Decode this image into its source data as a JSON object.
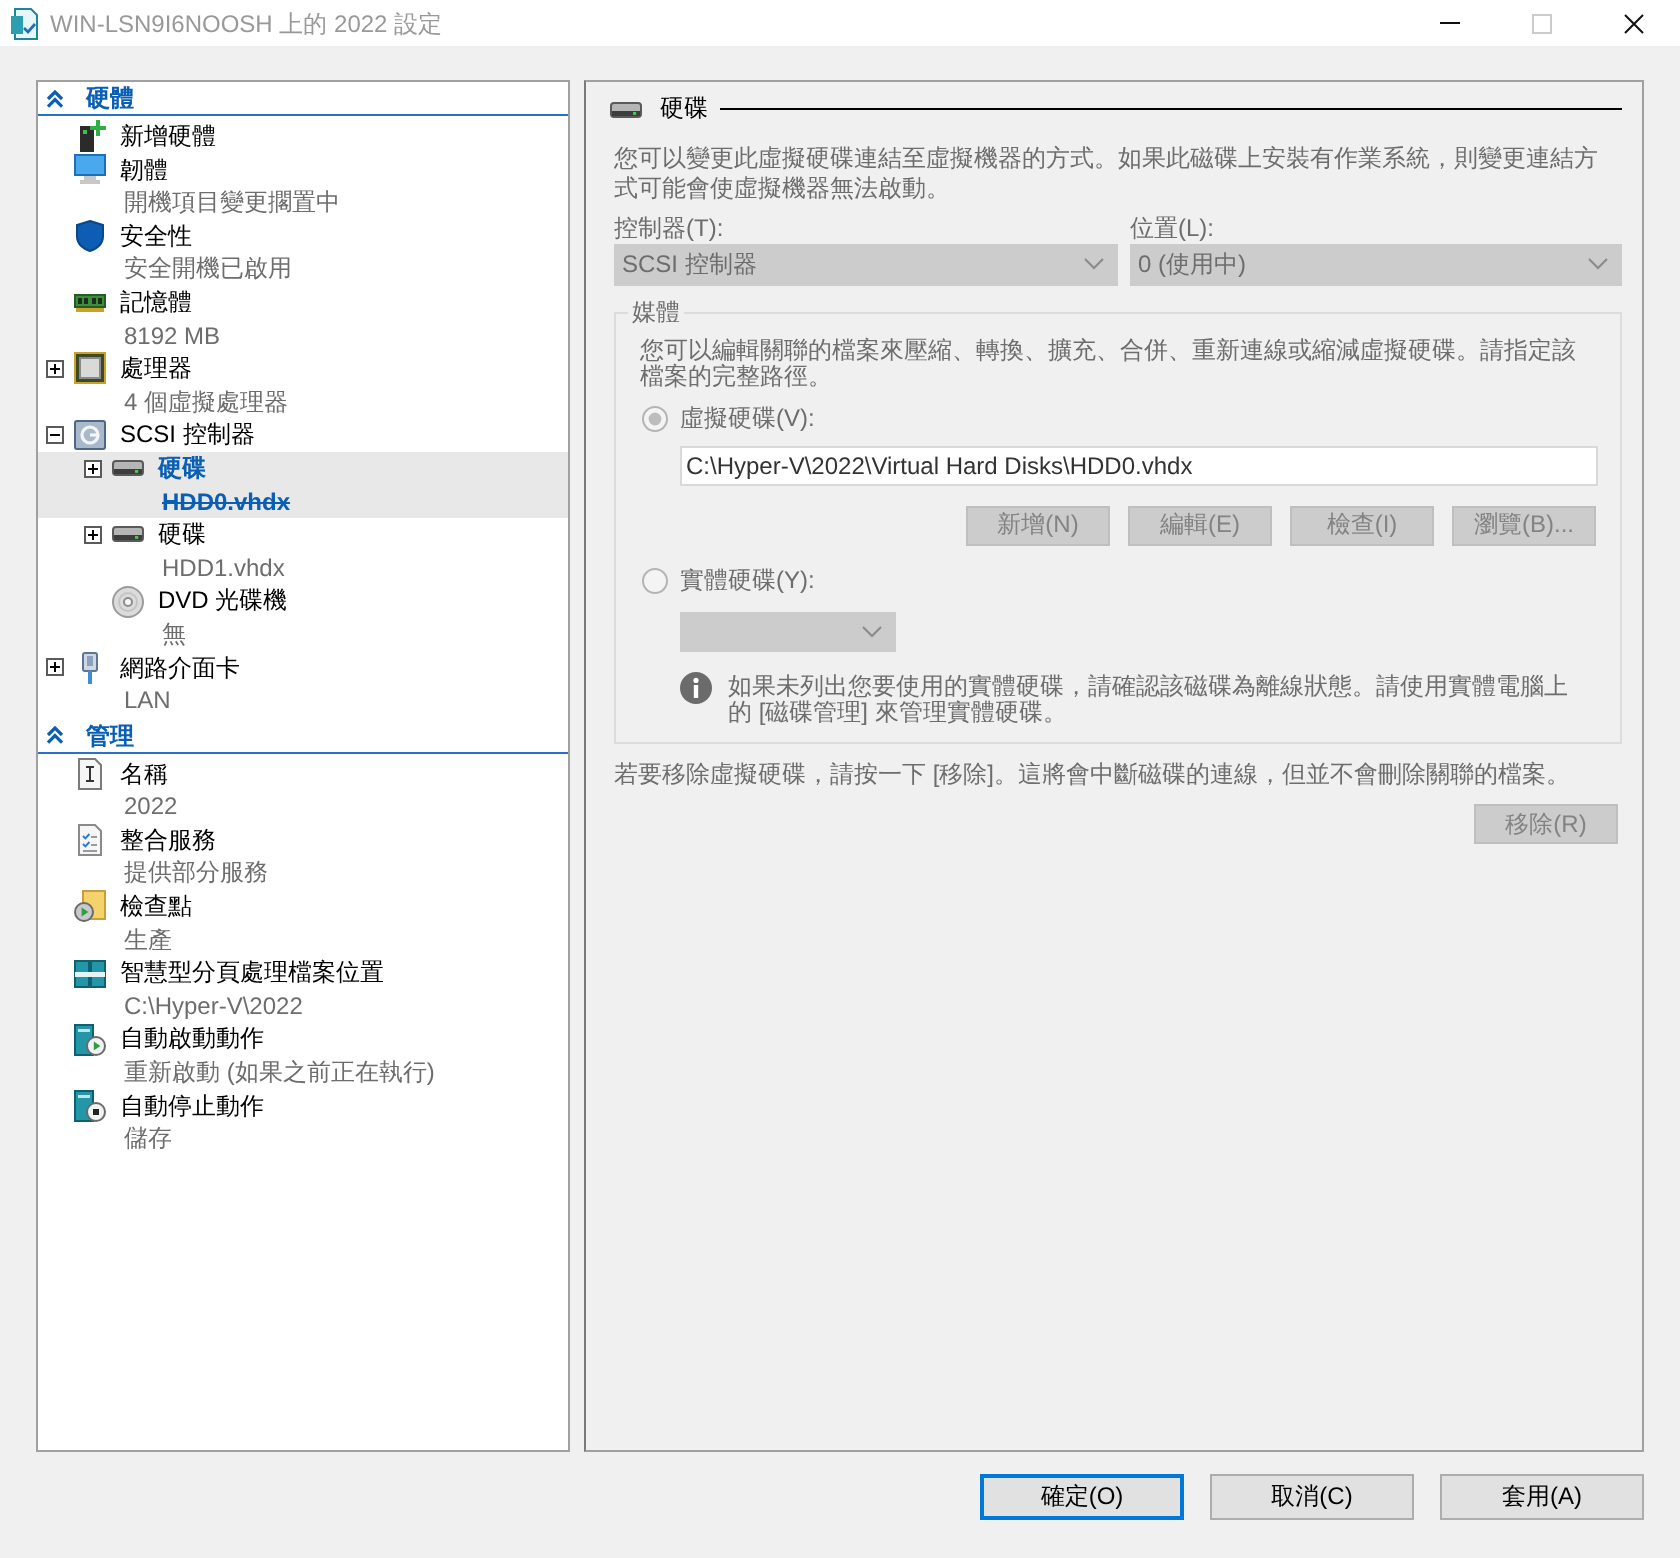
{
  "window": {
    "title": "WIN-LSN9I6NOOSH 上的 2022 設定",
    "active": false,
    "controls": [
      {
        "kind": "minimize",
        "disabled": false
      },
      {
        "kind": "maximize",
        "disabled": true
      },
      {
        "kind": "close",
        "disabled": false
      }
    ]
  },
  "sidebar": {
    "sections": [
      {
        "title": "硬體",
        "expanded": true,
        "items": [
          {
            "kind": "addhardware",
            "label": "新增硬體",
            "selected": false
          },
          {
            "kind": "firmware",
            "label": "韌體",
            "detail": "開機項目變更擱置中",
            "selected": false
          },
          {
            "kind": "security",
            "label": "安全性",
            "detail": "安全開機已啟用",
            "selected": false
          },
          {
            "kind": "memory",
            "label": "記憶體",
            "detail": "8192 MB",
            "selected": false
          },
          {
            "kind": "processor",
            "label": "處理器",
            "detail": "4 個虛擬處理器",
            "selected": false,
            "expanded": false
          },
          {
            "kind": "controller",
            "label": "SCSI 控制器",
            "selected": false,
            "expanded": true,
            "children": [
              {
                "kind": "disk",
                "label": "硬碟",
                "detail": "HDD0.vhdx",
                "selected": true,
                "expanded": false
              },
              {
                "kind": "disk",
                "label": "硬碟",
                "detail": "HDD1.vhdx",
                "selected": false,
                "expanded": false
              },
              {
                "kind": "dvd",
                "label": "DVD 光碟機",
                "detail": "無",
                "selected": false
              }
            ]
          },
          {
            "kind": "network",
            "label": "網路介面卡",
            "detail": "LAN",
            "selected": false,
            "expanded": false
          }
        ]
      },
      {
        "title": "管理",
        "expanded": true,
        "items": [
          {
            "kind": "name",
            "label": "名稱",
            "detail": "2022",
            "selected": false
          },
          {
            "kind": "integration",
            "label": "整合服務",
            "detail": "提供部分服務",
            "selected": false
          },
          {
            "kind": "checkpoint",
            "label": "檢查點",
            "detail": "生產",
            "selected": false
          },
          {
            "kind": "paging",
            "label": "智慧型分頁處理檔案位置",
            "detail": "C:\\Hyper-V\\2022",
            "selected": false
          },
          {
            "kind": "autostart",
            "label": "自動啟動動作",
            "detail": "重新啟動 (如果之前正在執行)",
            "selected": false
          },
          {
            "kind": "autostop",
            "label": "自動停止動作",
            "detail": "儲存",
            "selected": false
          }
        ]
      }
    ]
  },
  "details": {
    "kind": "disk",
    "title": "硬碟",
    "description": "您可以變更此虛擬硬碟連結至虛擬機器的方式。如果此磁碟上安裝有作業系統，則變更連結方式可能會使虛擬機器無法啟動。",
    "controller": {
      "label": "控制器(T):",
      "value": "SCSI 控制器",
      "disabled": true
    },
    "location": {
      "label": "位置(L):",
      "value": "0 (使用中)",
      "disabled": true
    },
    "media": {
      "title": "媒體",
      "description": "您可以編輯關聯的檔案來壓縮、轉換、擴充、合併、重新連線或縮減虛擬硬碟。請指定該檔案的完整路徑。",
      "virtual_disk": {
        "label": "虛擬硬碟(V):",
        "selected": true,
        "disabled": true,
        "path": "C:\\Hyper-V\\2022\\Virtual Hard Disks\\HDD0.vhdx",
        "buttons": [
          {
            "label": "新增(N)",
            "disabled": true
          },
          {
            "label": "編輯(E)",
            "disabled": true
          },
          {
            "label": "檢查(I)",
            "disabled": true
          },
          {
            "label": "瀏覽(B)...",
            "disabled": true
          }
        ]
      },
      "physical_disk": {
        "label": "實體硬碟(Y):",
        "selected": false,
        "disabled": true,
        "dropdown": {
          "disabled": true
        },
        "info": "如果未列出您要使用的實體硬碟，請確認該磁碟為離線狀態。請使用實體電腦上的 [磁碟管理] 來管理實體硬碟。"
      }
    },
    "remove_hint": "若要移除虛擬硬碟，請按一下 [移除]。這將會中斷磁碟的連線，但並不會刪除關聯的檔案。",
    "remove_button": {
      "label": "移除(R)",
      "disabled": true
    }
  },
  "buttons": [
    {
      "label": "確定(O)",
      "focused": true
    },
    {
      "label": "取消(C)",
      "focused": false
    },
    {
      "label": "套用(A)",
      "focused": false
    }
  ]
}
